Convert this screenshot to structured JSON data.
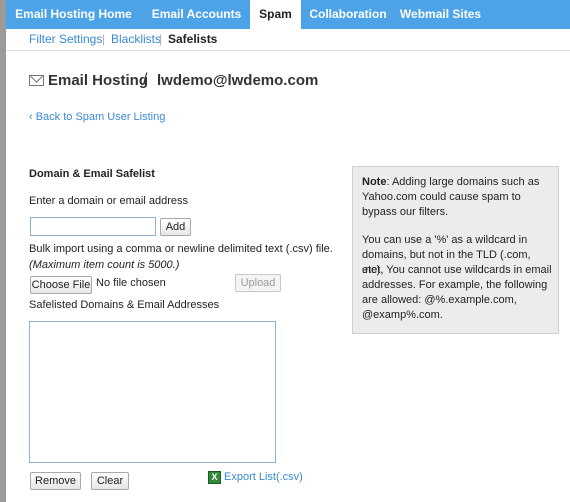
{
  "top_tabs": [
    {
      "label": "Email Hosting Home",
      "active": false
    },
    {
      "label": "Email Accounts",
      "active": false
    },
    {
      "label": "Spam",
      "active": true
    },
    {
      "label": "Collaboration",
      "active": false
    },
    {
      "label": "Webmail Sites",
      "active": false
    }
  ],
  "sub_nav": {
    "filter_settings": "Filter Settings",
    "separator": "|",
    "blacklists": "Blacklists",
    "safelists": "Safelists"
  },
  "header": {
    "icon": "envelope-icon",
    "section": "Email Hosting",
    "separator": "/",
    "account": "lwdemo@lwdemo.com"
  },
  "back_link": "‹ Back to Spam User Listing",
  "safelist": {
    "heading": "Domain & Email Safelist",
    "input_label": "Enter a domain or email address",
    "input_value": "",
    "add_button": "Add",
    "bulk_label": "Bulk import using a comma or newline delimited text (.csv) file.",
    "bulk_note": "(Maximum item count is 5000.)",
    "choose_file_button": "Choose File",
    "no_file_text": "No file chosen",
    "upload_button": "Upload",
    "list_label": "Safelisted Domains & Email Addresses",
    "list_items": [],
    "remove_button": "Remove",
    "clear_button": "Clear",
    "export_icon": "excel-icon",
    "export_link": "Export List(.csv)"
  },
  "note": {
    "title": "Note",
    "line1": ": Adding large domains such as",
    "line2": "Yahoo.com could cause spam to",
    "line3": "bypass our filters.",
    "line4": "You can use a '%' as a wildcard in",
    "line5": "domains, but not in the TLD (.com, .net,",
    "line6": "etc). You cannot use wildcards in email",
    "line7": "addresses. For example, the following",
    "line8": "are allowed: @%.example.com,",
    "line9": "@examp%.com."
  },
  "colors": {
    "nav_blue": "#4ca3e8",
    "link_blue": "#3a8ad4",
    "note_bg": "#ececec"
  }
}
